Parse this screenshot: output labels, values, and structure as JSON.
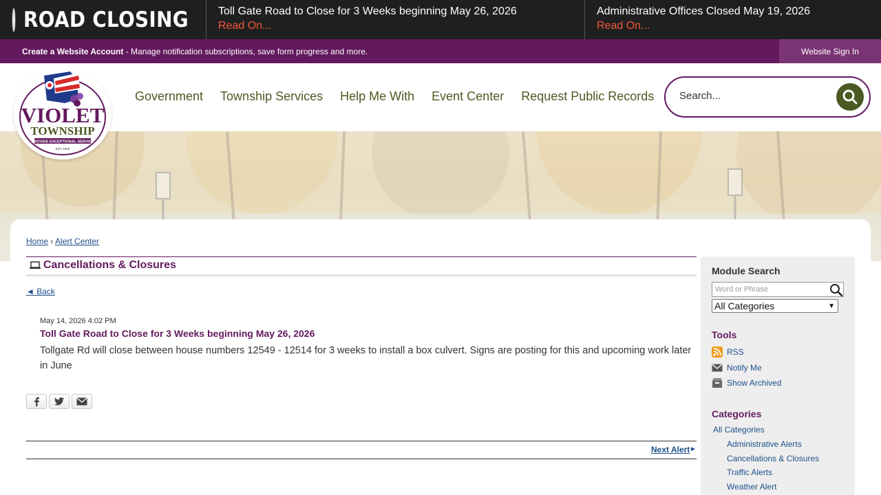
{
  "alert_bar": {
    "label": "ROAD CLOSING",
    "items": [
      {
        "title": "Toll Gate Road to Close for 3 Weeks beginning May 26, 2026",
        "link": "Read On..."
      },
      {
        "title": "Administrative Offices Closed May 19, 2026",
        "link": "Read On..."
      }
    ]
  },
  "account_bar": {
    "create_link": "Create a Website Account",
    "description": " - Manage notification subscriptions, save form progress and more.",
    "sign_in": "Website Sign In"
  },
  "logo": {
    "line1": "VIOLET",
    "line2": "TOWNSHIP",
    "tagline": "PROVIDE EXCEPTIONAL SERVICE",
    "est": "EST. 1808"
  },
  "nav": {
    "items": [
      "Government",
      "Township Services",
      "Help Me With",
      "Event Center",
      "Request Public Records"
    ]
  },
  "search": {
    "placeholder": "Search..."
  },
  "breadcrumb": {
    "home": "Home",
    "separator": "›",
    "current": "Alert Center"
  },
  "module": {
    "title": "Cancellations & Closures"
  },
  "back": {
    "label": "◄ Back"
  },
  "post": {
    "date": "May 14, 2026 4:02 PM",
    "title": "Toll Gate Road to Close for 3 Weeks beginning May 26, 2026",
    "body": "Tollgate Rd will close between house numbers 12549 - 12514 for 3 weeks to install a box culvert. Signs are posting for this and upcoming work later in June"
  },
  "pager": {
    "next": "Next Alert",
    "next_arrow": "►"
  },
  "sidebar": {
    "module_search": {
      "heading": "Module Search",
      "placeholder": "Word or Phrase",
      "selected_category": "All Categories"
    },
    "tools": {
      "heading": "Tools",
      "items": [
        "RSS",
        "Notify Me",
        "Show Archived"
      ]
    },
    "categories": {
      "heading": "Categories",
      "all": "All Categories",
      "items": [
        "Administrative Alerts",
        "Cancellations & Closures",
        "Traffic Alerts",
        "Weather Alert"
      ]
    }
  },
  "colors": {
    "alert_bar_bg": "#1f1f1f",
    "alert_link": "#f05a3a",
    "purple": "#63195e",
    "nav_green": "#4b5a23",
    "link_blue": "#1c4f8a"
  }
}
